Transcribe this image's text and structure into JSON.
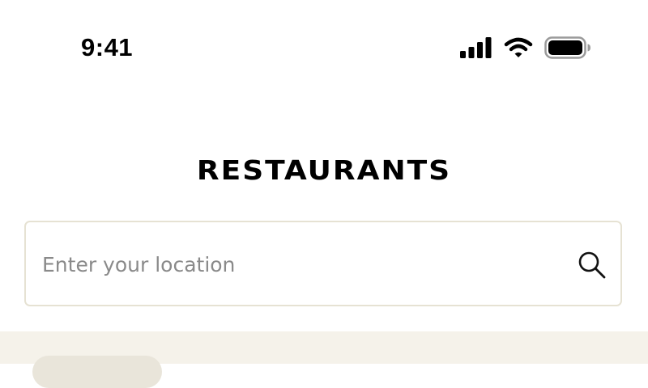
{
  "status_bar": {
    "time": "9:41"
  },
  "header": {
    "title": "RESTAURANTS"
  },
  "search": {
    "value": "",
    "placeholder": "Enter your location"
  },
  "icons": {
    "signal": "cellular-signal-icon",
    "wifi": "wifi-icon",
    "battery": "battery-icon",
    "search": "search-icon"
  },
  "colors": {
    "search_border": "#e6e2d3",
    "panel_background": "#f5f2ea",
    "chip_background": "#e9e5da",
    "placeholder_text": "#8a8a8a"
  }
}
